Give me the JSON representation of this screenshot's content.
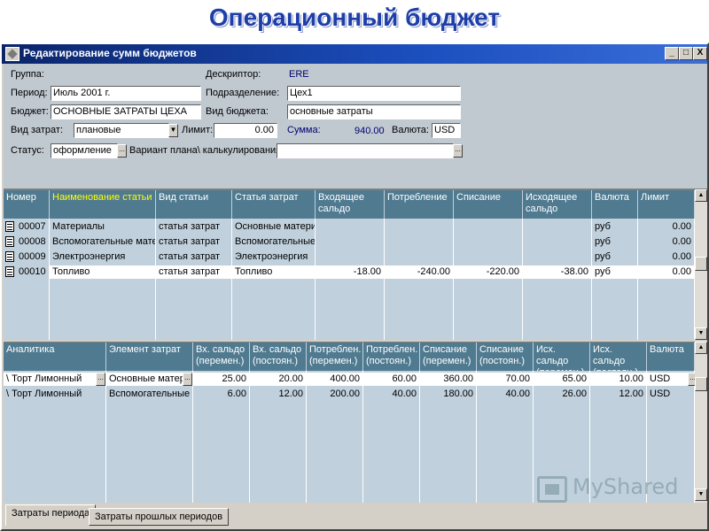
{
  "slide": {
    "title": "Операционный бюджет"
  },
  "window": {
    "title": "Редактирование сумм бюджетов",
    "controls": {
      "minimize": "_",
      "maximize": "□",
      "close": "X"
    },
    "icon": "app-diamond-icon"
  },
  "form": {
    "group_label": "Группа:",
    "descriptor_label": "Дескриптор:",
    "descriptor_value": "ERE",
    "period_label": "Период:",
    "period_value": "Июль 2001 г.",
    "division_label": "Подразделение:",
    "division_value": "Цех1",
    "budget_label": "Бюджет:",
    "budget_value": "ОСНОВНЫЕ ЗАТРАТЫ ЦЕХА",
    "budget_type_label": "Вид бюджета:",
    "budget_type_value": "основные затраты",
    "cost_type_label": "Вид затрат:",
    "cost_type_value": "плановые",
    "limit_label": "Лимит:",
    "limit_value": "0.00",
    "sum_label": "Сумма:",
    "sum_value": "940.00",
    "currency_label": "Валюта:",
    "currency_value": "USD",
    "status_label": "Статус:",
    "status_value": "оформление",
    "plan_variant_label": "Вариант плана\\ калькулирования:",
    "plan_variant_value": ""
  },
  "top_table": {
    "headers": [
      "Номер",
      "Наименование статьи",
      "Вид статьи",
      "Статья затрат",
      "Входящее сальдо",
      "Потребление",
      "Списание",
      "Исходящее сальдо",
      "Валюта",
      "Лимит"
    ],
    "rows": [
      [
        "00007",
        "Материалы",
        "статья затрат",
        "Основные материа",
        "",
        "",
        "",
        "",
        "руб",
        "0.00"
      ],
      [
        "00008",
        "Вспомогательные матер",
        "статья затрат",
        "Вспомогательные м",
        "",
        "",
        "",
        "",
        "руб",
        "0.00"
      ],
      [
        "00009",
        "Электроэнергия",
        "статья затрат",
        "Электроэнергия",
        "",
        "",
        "",
        "",
        "руб",
        "0.00"
      ],
      [
        "00010",
        "Топливо",
        "статья затрат",
        "Топливо",
        "-18.00",
        "-240.00",
        "-220.00",
        "-38.00",
        "руб",
        "0.00"
      ]
    ]
  },
  "bottom_table": {
    "headers": [
      "Аналитика",
      "Элемент затрат",
      "Вх. сальдо (перемен.)",
      "Вх. сальдо (постоян.)",
      "Потреблен. (перемен.)",
      "Потреблен. (постоян.)",
      "Списание (перемен.)",
      "Списание (постоян.)",
      "Исх. сальдо (перемен.)",
      "Исх. сальдо (постоян.)",
      "Валюта"
    ],
    "rows": [
      [
        "\\ Торт Лимонный",
        "Основные матери",
        "25.00",
        "20.00",
        "400.00",
        "60.00",
        "360.00",
        "70.00",
        "65.00",
        "10.00",
        "USD"
      ],
      [
        "\\ Торт Лимонный",
        "Вспомогательные м",
        "6.00",
        "12.00",
        "200.00",
        "40.00",
        "180.00",
        "40.00",
        "26.00",
        "12.00",
        "USD"
      ]
    ]
  },
  "tabs": [
    "Затраты периода",
    "Затраты прошлых периодов"
  ],
  "watermark": {
    "text": "MyShared",
    "icon": "projector-screen-icon"
  },
  "colors": {
    "header_bg": "#4f7a90",
    "grid_bg": "#c0d0dc",
    "selected_header_text": "#ffff00",
    "title_blue": "#1f3fa8"
  }
}
